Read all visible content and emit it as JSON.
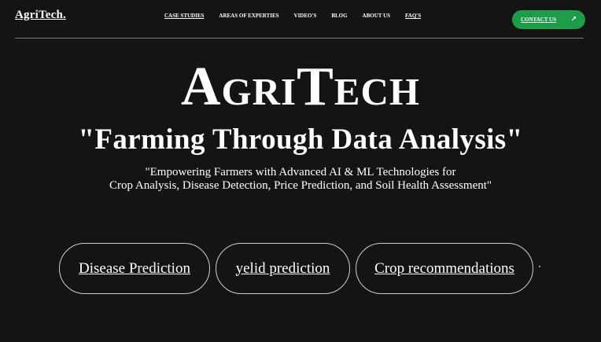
{
  "header": {
    "logo": "AgriTech.",
    "nav": [
      {
        "label": "CASE STUDIES",
        "underlined": true
      },
      {
        "label": "AREAS OF EXPERTIES",
        "underlined": false
      },
      {
        "label": "VIDEO'S",
        "underlined": false
      },
      {
        "label": "BLOG",
        "underlined": false
      },
      {
        "label": "ABOUT US",
        "underlined": false
      },
      {
        "label": "FAQ'S",
        "underlined": true
      }
    ],
    "contact": {
      "label": "CONTACT US",
      "icon": "arrow-icon",
      "color": "#1d9c4a"
    }
  },
  "hero": {
    "brand": "AgriTech",
    "tagline": "\"Farming Through Data Analysis\"",
    "desc_line1": "\"Empowering Farmers with Advanced AI & ML Technologies for",
    "desc_line2": "Crop Analysis, Disease Detection, Price Prediction, and Soil Health Assessment\""
  },
  "features": [
    {
      "label": "Disease Prediction"
    },
    {
      "label": "yelid prediction"
    },
    {
      "label": "Crop recommendations"
    }
  ]
}
